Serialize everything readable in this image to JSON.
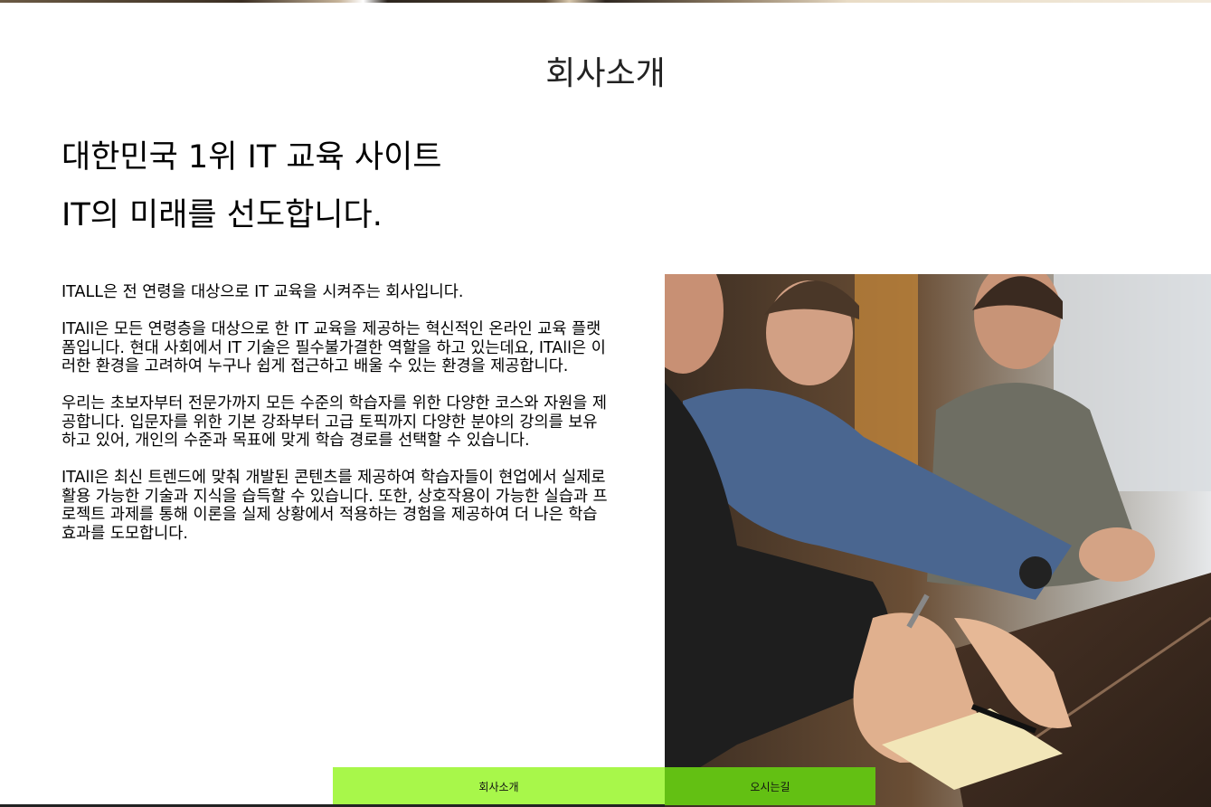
{
  "page": {
    "title": "회사소개"
  },
  "headline": {
    "line1": "대한민국 1위 IT 교육 사이트",
    "line2": "IT의 미래를 선도합니다."
  },
  "intro": {
    "paragraphs": [
      "ITALL은 전 연령을 대상으로 IT 교육을 시켜주는 회사입니다.",
      "ITAll은 모든 연령층을 대상으로 한 IT 교육을 제공하는 혁신적인 온라인 교육 플랫폼입니다. 현대 사회에서 IT 기술은 필수불가결한 역할을 하고 있는데요, ITAll은 이러한 환경을 고려하여 누구나 쉽게 접근하고 배울 수 있는 환경을 제공합니다.",
      "우리는 초보자부터 전문가까지 모든 수준의 학습자를 위한 다양한 코스와 자원을 제공합니다. 입문자를 위한 기본 강좌부터 고급 토픽까지 다양한 분야의 강의를 보유하고 있어, 개인의 수준과 목표에 맞게 학습 경로를 선택할 수 있습니다.",
      "ITAll은 최신 트렌드에 맞춰 개발된 콘텐츠를 제공하여 학습자들이 현업에서 실제로 활용 가능한 기술과 지식을 습득할 수 있습니다. 또한, 상호작용이 가능한 실습과 프로젝트 과제를 통해 이론을 실제 상황에서 적용하는 경험을 제공하여 더 나은 학습 효과를 도모합니다."
    ]
  },
  "photo": {
    "icon": "classroom-photo"
  },
  "tabs": {
    "about_label": "회사소개",
    "directions_label": "오시는길"
  },
  "colors": {
    "tab_about": "#a8f74a",
    "tab_directions": "#63c013"
  }
}
